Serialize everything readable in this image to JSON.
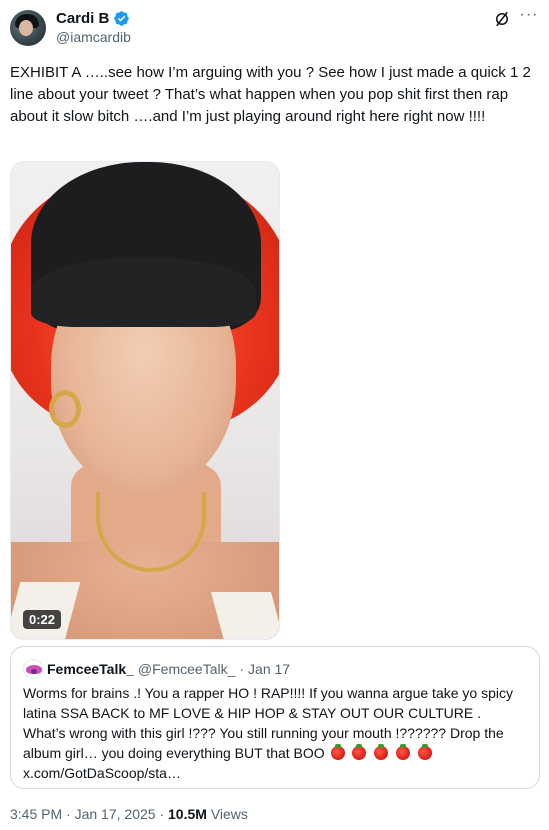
{
  "author": {
    "display_name": "Cardi B",
    "handle": "@iamcardib",
    "verified": true
  },
  "icons": {
    "verified": "verified-badge-icon",
    "grok": "grok-icon",
    "more": "more-options-icon"
  },
  "tweet": {
    "text": "EXHIBIT A …..see how I’m arguing with you ? See how I just made a quick 1 2 line about your tweet ? That’s what happen when you pop shit first then rap about it slow bitch ….and I’m just playing around right here right now !!!!"
  },
  "media": {
    "duration": "0:22"
  },
  "quote": {
    "display_name": "FemceeTalk_",
    "handle": "@FemceeTalk_",
    "separator": "·",
    "time": "Jan 17",
    "text_main": "Worms for brains .! You a rapper HO ! RAP!!!! If you wanna argue take yo spicy latina SSA BACK to MF LOVE & HIP HOP & STAY OUT OUR CULTURE . What’s wrong with this girl !??? You still running your mouth !?????? Drop the album girl… you doing everything BUT that BOO",
    "link": "x.com/GotDaScoop/sta…"
  },
  "meta": {
    "time": "3:45 PM",
    "separator": " · ",
    "date": "Jan 17, 2025",
    "views_count": "10.5M",
    "views_label": "Views"
  },
  "colors": {
    "text_primary": "#0f1419",
    "text_secondary": "#536471",
    "verified_blue": "#1d9bf0",
    "border": "#cfd9de"
  }
}
